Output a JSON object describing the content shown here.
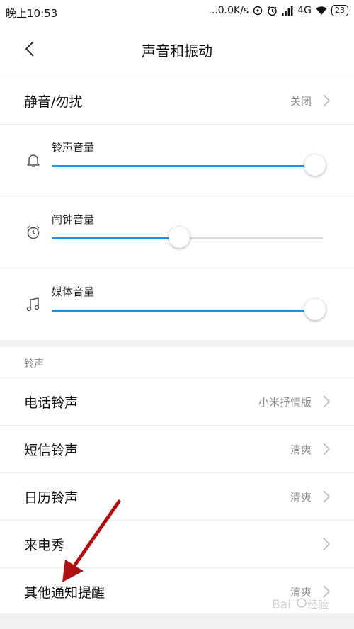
{
  "status_bar": {
    "time": "晚上10:53",
    "network_speed": "...0.0K/s",
    "network_type": "4G",
    "battery": "23"
  },
  "header": {
    "title": "声音和振动"
  },
  "mute_row": {
    "label": "静音/勿扰",
    "value": "关闭"
  },
  "volumes": [
    {
      "label": "铃声音量",
      "icon": "bell-icon",
      "level": 0.97
    },
    {
      "label": "闹钟音量",
      "icon": "alarm-clock-icon",
      "level": 0.47
    },
    {
      "label": "媒体音量",
      "icon": "music-note-icon",
      "level": 0.97
    }
  ],
  "ringtone_section": {
    "header": "铃声",
    "items": [
      {
        "label": "电话铃声",
        "value": "小米抒情版"
      },
      {
        "label": "短信铃声",
        "value": "清爽"
      },
      {
        "label": "日历铃声",
        "value": "清爽"
      },
      {
        "label": "来电秀",
        "value": ""
      },
      {
        "label": "其他通知提醒",
        "value": "清爽"
      }
    ]
  },
  "colors": {
    "accent": "#1f8ee6",
    "annotation_arrow": "#b01212"
  }
}
